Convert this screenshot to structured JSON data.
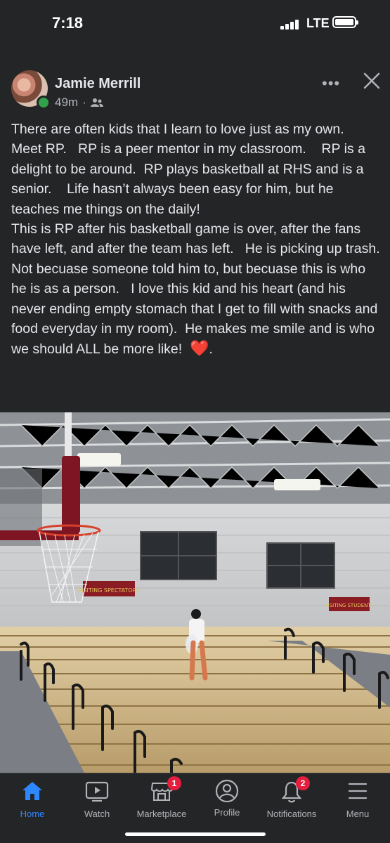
{
  "status_bar": {
    "time": "7:18",
    "network": "LTE"
  },
  "post": {
    "author": "Jamie Merrill",
    "time_ago": "49m",
    "separator": "·",
    "audience_icon": "friends-icon",
    "text": "There are often kids that I learn to love just as my own.   Meet RP.   RP is a peer mentor in my classroom.    RP is a delight to be around.  RP plays basketball at RHS and is a senior.    Life hasn’t always been easy for him, but he teaches me things on the daily!\nThis is RP after his basketball game is over, after the fans have left, and after the team has left.   He is picking up trash.  Not becuase someone told him to, but becuase this is who he is as a person.   I love this kid and his heart (and his never ending empty stomach that I get to fill with snacks and food everyday in my room).  He makes me smile and is who we should ALL be more like!  ",
    "emoji": "❤️",
    "text_end": ".",
    "photo": {
      "signs": [
        "VISITING SPECTATORS",
        "VISITING STUDENTS"
      ]
    }
  },
  "tabs": [
    {
      "label": "Home",
      "icon": "home-icon",
      "active": true
    },
    {
      "label": "Watch",
      "icon": "watch-icon"
    },
    {
      "label": "Marketplace",
      "icon": "marketplace-icon",
      "badge": "1"
    },
    {
      "label": "Profile",
      "icon": "profile-icon"
    },
    {
      "label": "Notifications",
      "icon": "bell-icon",
      "badge": "2"
    },
    {
      "label": "Menu",
      "icon": "menu-icon"
    }
  ],
  "colors": {
    "background": "#242526",
    "accent": "#2d88ff",
    "badge": "#e41e3f",
    "online": "#31a24c"
  }
}
